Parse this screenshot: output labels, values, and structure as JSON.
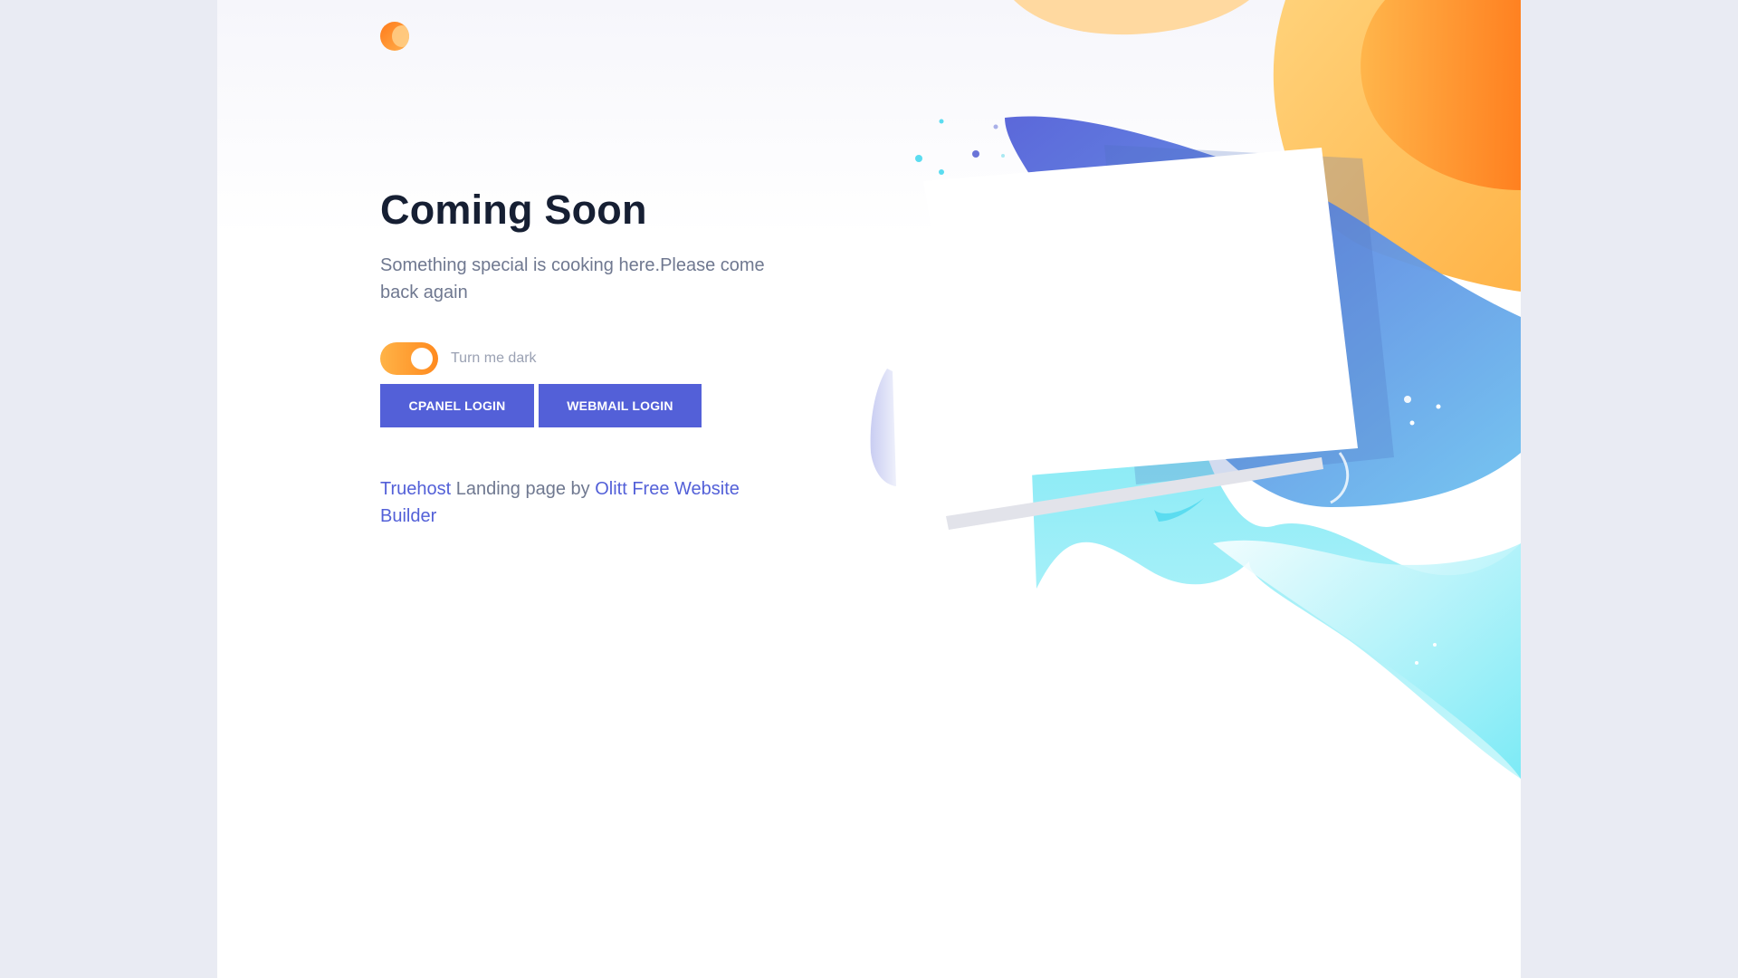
{
  "brand": {
    "logo_icon": "orange-circle-logo",
    "accent_color": "#5360d8",
    "toggle_color": "#ff9a2e"
  },
  "hero": {
    "title": "Coming Soon",
    "subtitle": "Something special is cooking here.Please come back again"
  },
  "theme_toggle": {
    "label": "Turn me dark",
    "state": "on"
  },
  "buttons": {
    "cpanel_label": "CPANEL LOGIN",
    "webmail_label": "WEBMAIL LOGIN"
  },
  "credits": {
    "link1": "Truehost",
    "middle": " Landing page by ",
    "link2": "Olitt Free Website Builder"
  }
}
